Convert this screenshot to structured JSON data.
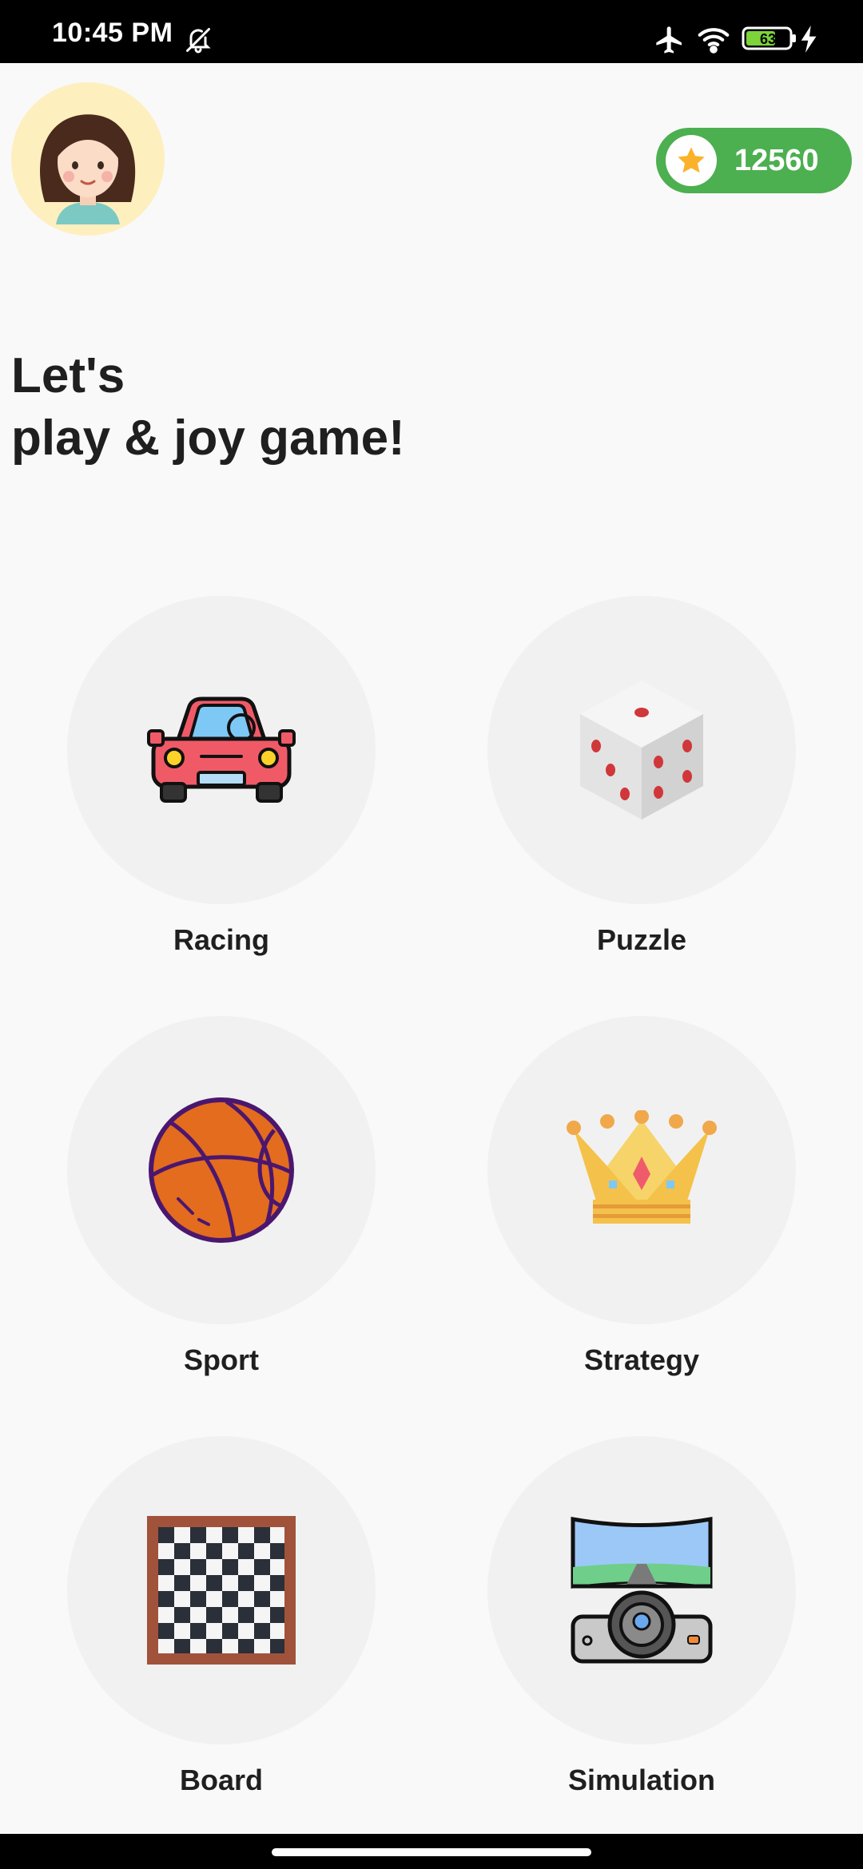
{
  "status_bar": {
    "time": "10:45 PM",
    "battery": "63",
    "icons": [
      "bell-off-icon",
      "airplane-icon",
      "wifi-icon",
      "battery-icon",
      "charging-icon"
    ]
  },
  "header": {
    "avatar_icon": "girl-avatar-icon",
    "coins": "12560",
    "coin_icon": "star-icon"
  },
  "headline": {
    "line1": "Let's",
    "line2": "play & joy game!"
  },
  "categories": [
    {
      "label": "Racing",
      "icon": "car-icon"
    },
    {
      "label": "Puzzle",
      "icon": "dice-icon"
    },
    {
      "label": "Sport",
      "icon": "basketball-icon"
    },
    {
      "label": "Strategy",
      "icon": "crown-icon"
    },
    {
      "label": "Board",
      "icon": "chessboard-icon"
    },
    {
      "label": "Simulation",
      "icon": "driving-simulator-icon"
    }
  ],
  "colors": {
    "accent_green": "#4caf50",
    "avatar_bg": "#feefbf",
    "circle_bg": "#f1f1f1",
    "star": "#fbb22b"
  }
}
